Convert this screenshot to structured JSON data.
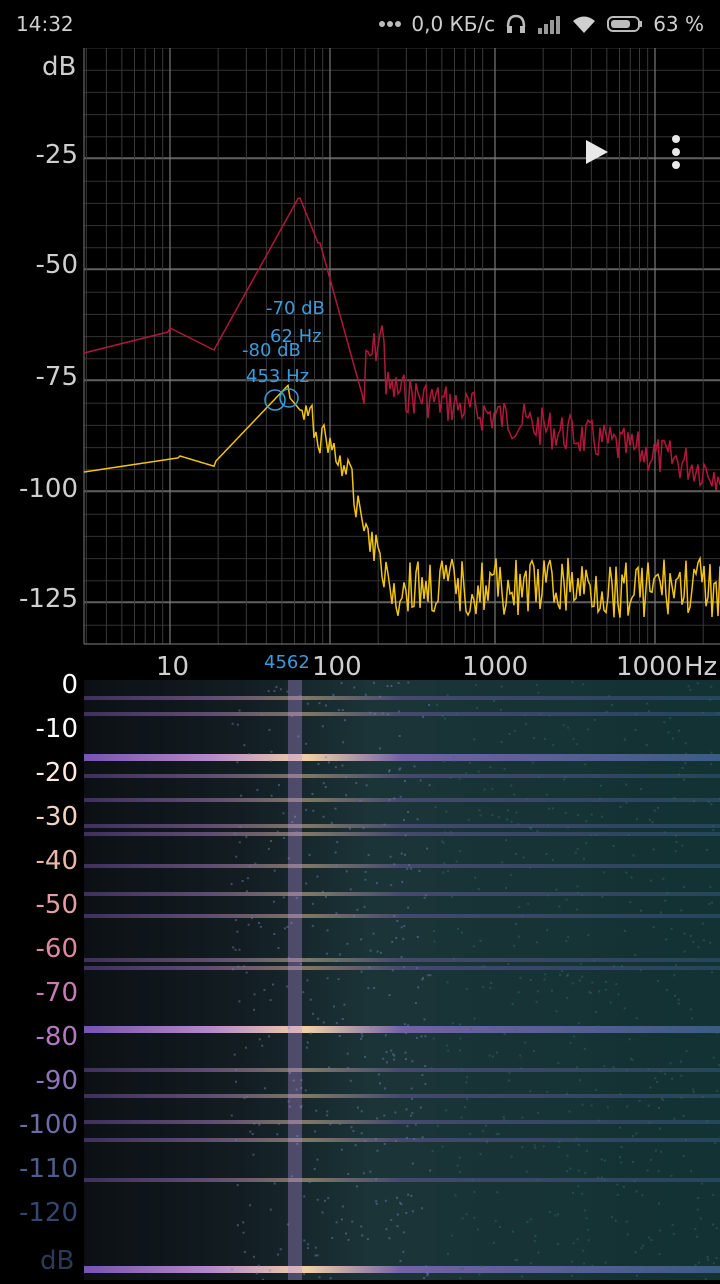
{
  "status_bar": {
    "time": "14:32",
    "network_speed": "0,0 КБ/с",
    "battery": "63 %"
  },
  "graph": {
    "y_unit": "dB",
    "y_ticks": [
      "-25",
      "-50",
      "-75",
      "-100",
      "-125"
    ],
    "x_ticks": [
      "10",
      "100",
      "1000",
      "1000"
    ],
    "x_unit": "Hz",
    "marker1": {
      "db": "-70 dB",
      "hz": "62 Hz"
    },
    "marker2": {
      "db": "-80 dB",
      "hz": "453 Hz"
    },
    "cursor_label": "4562",
    "colors": {
      "peak_line": "#b0173a",
      "live_line": "#f1c40f",
      "marker": "#3b9bd9",
      "grid": "#4a4a4a"
    }
  },
  "spectrogram": {
    "y_ticks": [
      "0",
      "-10",
      "-20",
      "-30",
      "-40",
      "-50",
      "-60",
      "-70",
      "-80",
      "-90",
      "-100",
      "-110",
      "-120"
    ],
    "y_unit": "dB",
    "tick_colors": [
      "#ffffff",
      "#ffffff",
      "#ffe9e0",
      "#f3d3c2",
      "#eab7a8",
      "#e2a0a2",
      "#d98aa2",
      "#c67eb1",
      "#b27abf",
      "#8f74b7",
      "#6e6ca6",
      "#4f5d8c",
      "#34466d"
    ]
  },
  "toolbar": {
    "play_icon": "play-icon",
    "menu_icon": "more-vert-icon"
  }
}
